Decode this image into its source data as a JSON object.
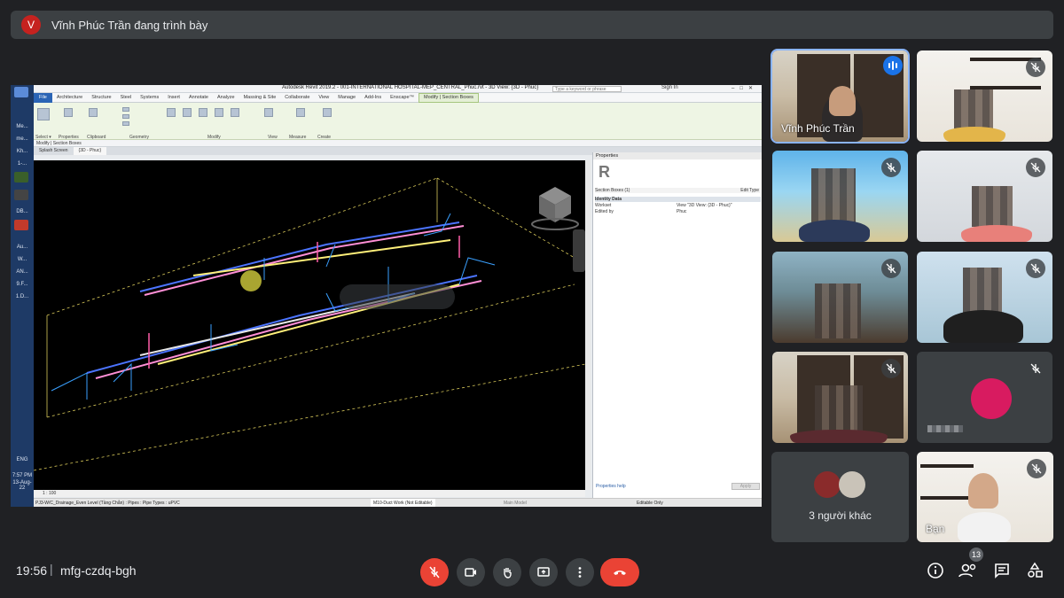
{
  "presenter": {
    "avatar_letter": "V",
    "text": "Vĩnh Phúc Trần đang trình bày"
  },
  "revit": {
    "title": "Autodesk Revit 2019.2 - 001-INTERNATIONAL HOSPITAL-MEP_CENTRAL_Phuc.rvt - 3D View: {3D - Phuc}",
    "search_placeholder": "Type a keyword or phrase",
    "sign_in": "Sign In",
    "tabs": [
      "File",
      "Architecture",
      "Structure",
      "Steel",
      "Systems",
      "Insert",
      "Annotate",
      "Analyze",
      "Massing & Site",
      "Collaborate",
      "View",
      "Manage",
      "Add-Ins",
      "Enscape™",
      "Modify | Section Boxes"
    ],
    "ribbon_groups": [
      "Select ▾",
      "Properties",
      "Clipboard",
      "Geometry",
      "Modify",
      "View",
      "Measure",
      "Create"
    ],
    "ribbon_tools": [
      "Modify",
      "Cope ▾",
      "Cut ▾",
      "Join ▾",
      "Paste"
    ],
    "context_label": "Modify | Section Boxes",
    "doc_tabs": [
      "Splash Screen",
      "{3D - Phuc}"
    ],
    "properties": {
      "header": "Properties",
      "logo": "R",
      "type_selector": "Section Boxes (1)",
      "edit_type": "Edit Type",
      "section": "Identity Data",
      "rows": [
        {
          "name": "Workset",
          "value": "View \"3D View: {3D - Phuc}\""
        },
        {
          "name": "Edited by",
          "value": "Phuc"
        }
      ],
      "help_link": "Properties help",
      "apply": "Apply"
    },
    "view_scale": "1 : 100",
    "status_left": "PJ3-W/C_Drainage_Even Level (Tầng Chẵn) : Pipes : Pipe Types : uPVC",
    "workset": "M10-Duct Work (Not Editable)",
    "editable_only": "Editable Only",
    "main_model": "Main Model"
  },
  "taskbar": {
    "labels": [
      "Me...",
      "me...",
      "Kh...",
      "1-...",
      "DB...",
      "Au...",
      "W...",
      "AN...",
      "9.F...",
      "1.D..."
    ],
    "language": "ENG",
    "time": "7:57 PM",
    "date": "13-Aug-22"
  },
  "participants": [
    {
      "name": "Vĩnh Phúc Trần",
      "speaking": true
    },
    {
      "name": "",
      "muted": true
    },
    {
      "name": "",
      "muted": true
    },
    {
      "name": "",
      "muted": true
    },
    {
      "name": "",
      "muted": true
    },
    {
      "name": "",
      "muted": true
    },
    {
      "name": "",
      "muted": true
    },
    {
      "name": "",
      "muted": true
    },
    {
      "name": "Bạn",
      "muted": true
    }
  ],
  "others": {
    "label": "3 người khác"
  },
  "bottom": {
    "time": "19:56",
    "separator": "|",
    "meeting_code": "mfg-czdq-bgh",
    "people_count": "13"
  },
  "colors": {
    "background": "#202124",
    "muted_red": "#ea4335",
    "speaking_blue": "#1a73e8",
    "revit_tab_blue": "#2a64b5"
  }
}
